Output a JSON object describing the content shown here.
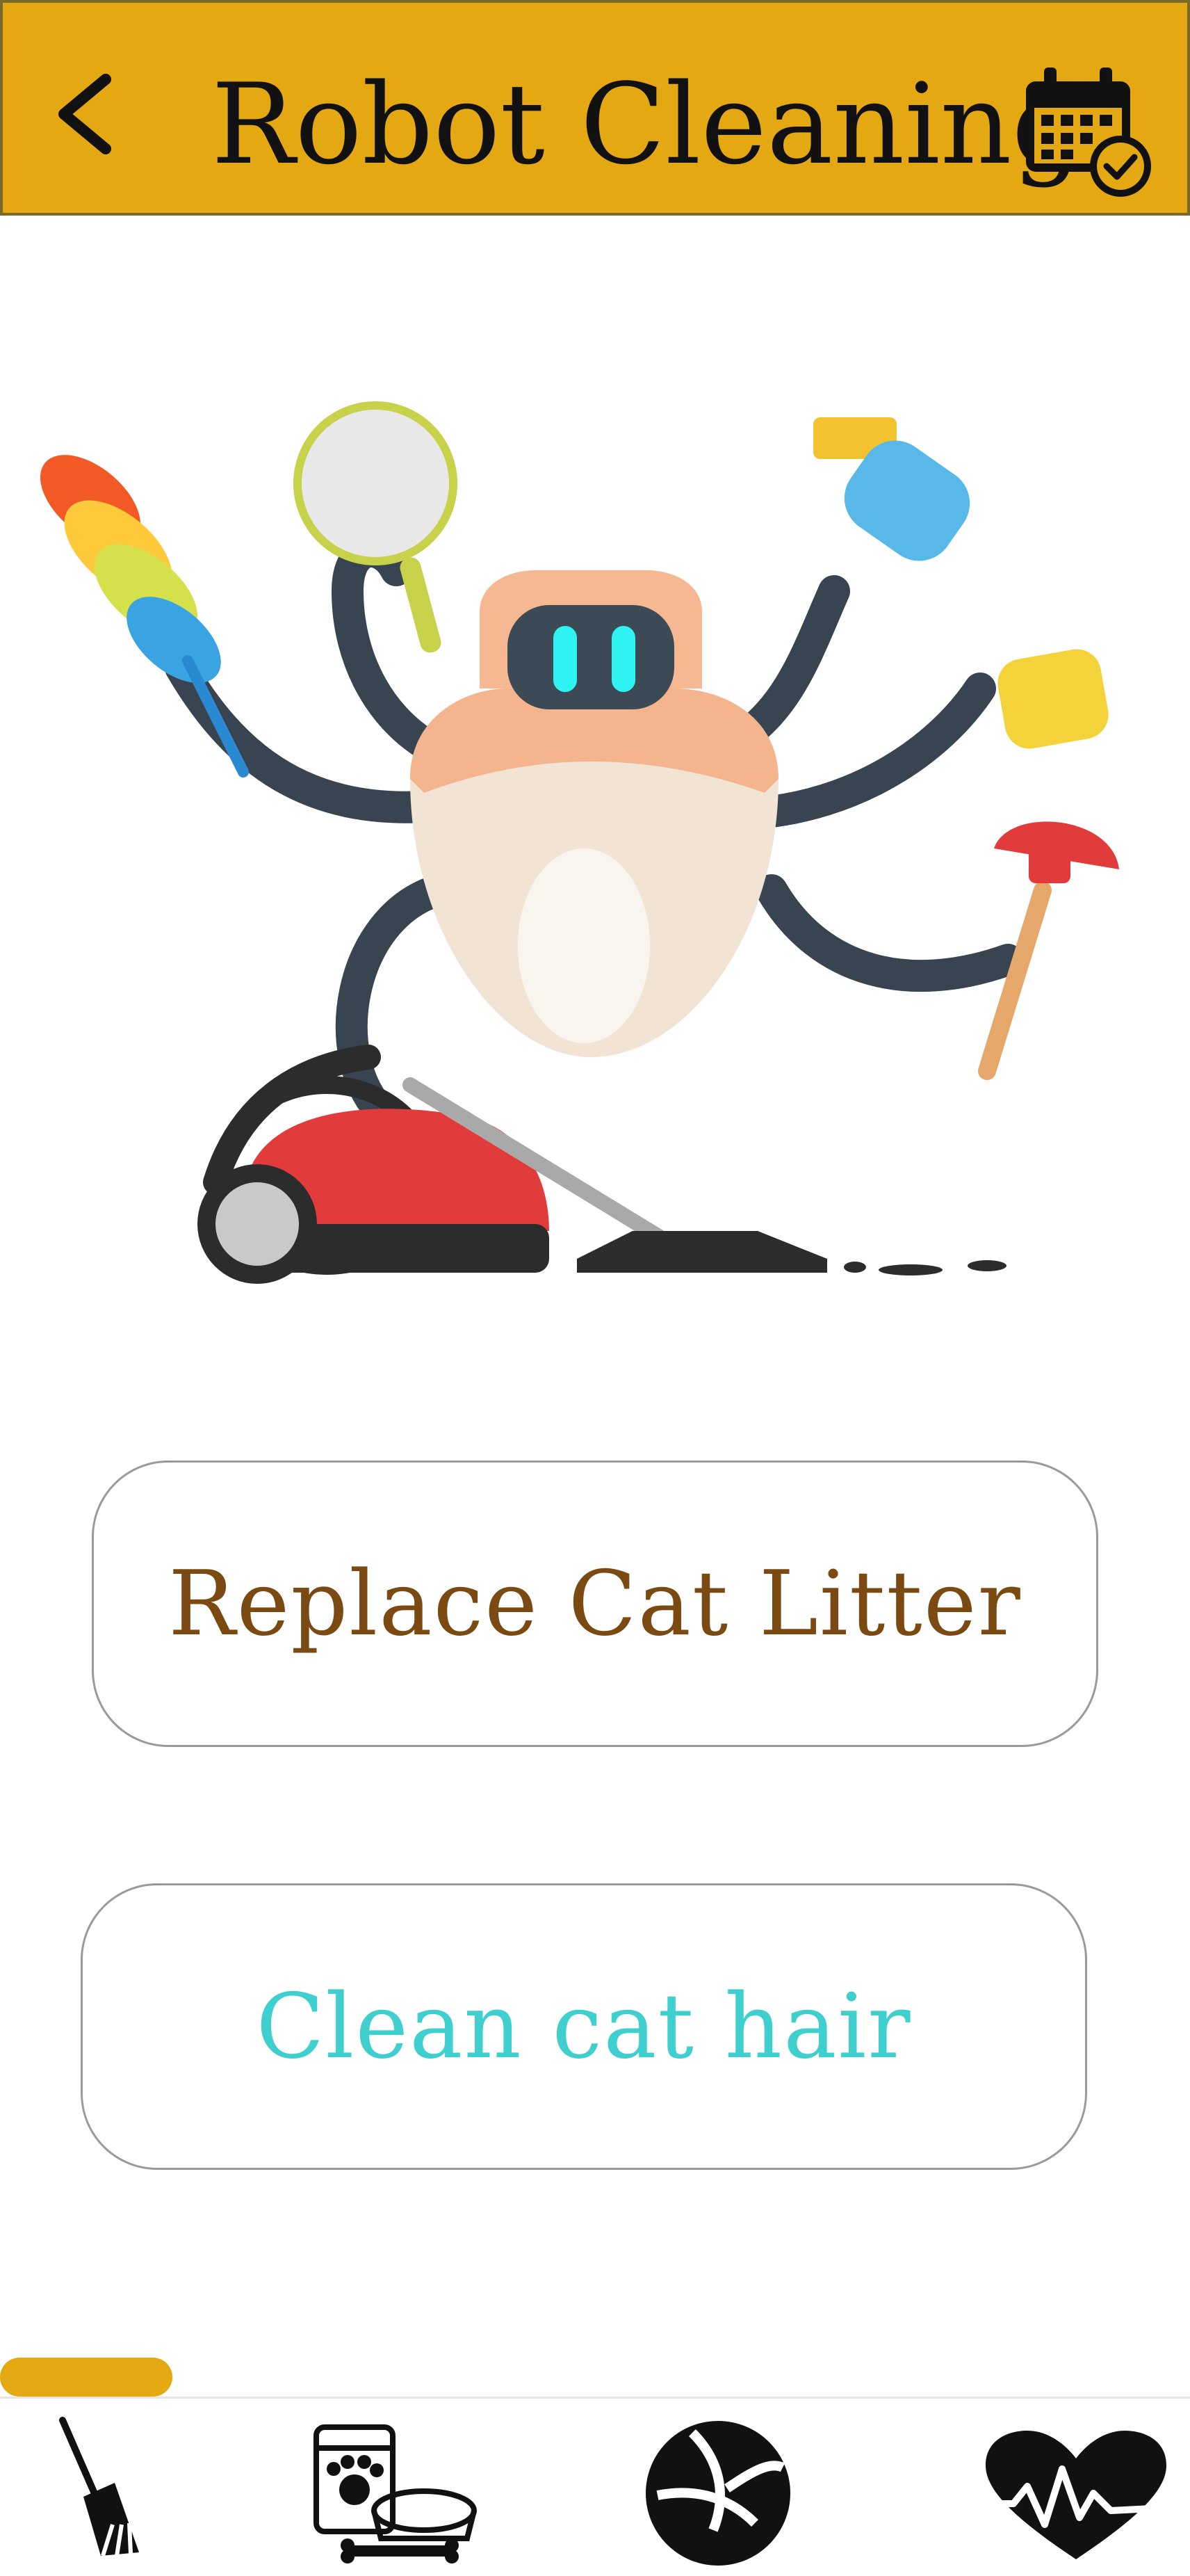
{
  "header": {
    "title": "Robot Cleaning",
    "back_icon": "chevron-left-icon",
    "calendar_icon": "calendar-check-icon",
    "background_color": "#e3a812"
  },
  "hero": {
    "illustration": "robot-cleaning-illustration"
  },
  "actions": [
    {
      "label": "Replace Cat Litter",
      "color": "#7a4a12"
    },
    {
      "label": "Clean cat hair",
      "color": "#3fcfcf"
    }
  ],
  "bottom_nav": {
    "active_index": 0,
    "items": [
      {
        "icon": "broom-icon"
      },
      {
        "icon": "pet-food-icon"
      },
      {
        "icon": "ball-icon"
      },
      {
        "icon": "heartbeat-icon"
      }
    ]
  }
}
